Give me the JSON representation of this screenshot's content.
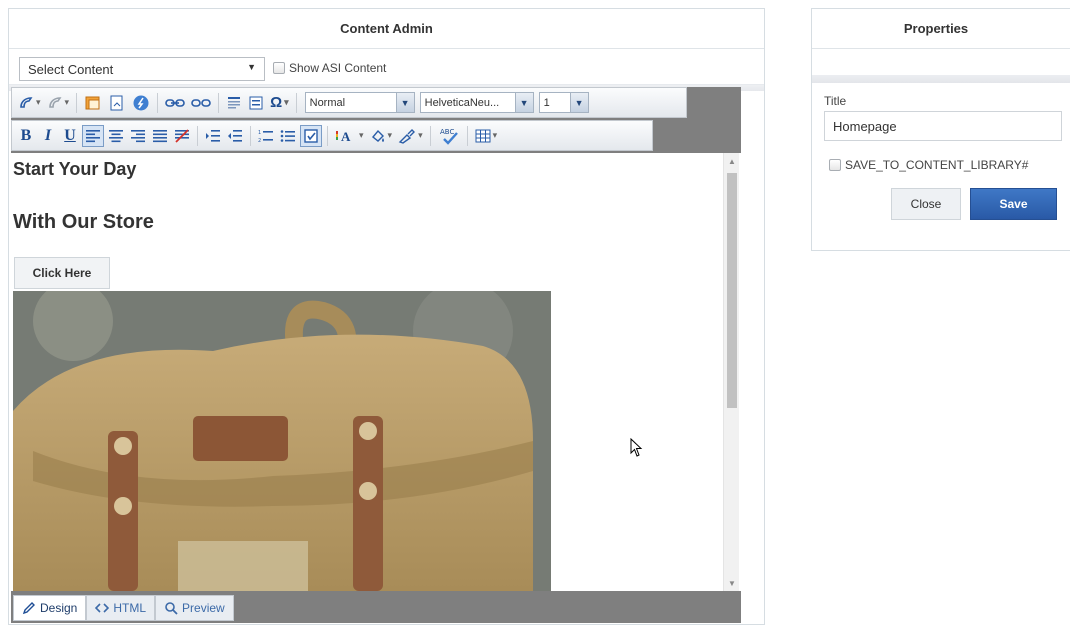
{
  "content_admin": {
    "title": "Content Admin",
    "select_value": "Select Content",
    "show_asi_label": "Show ASI Content"
  },
  "toolbar": {
    "style_value": "Normal",
    "font_value": "HelveticaNeu...",
    "size_value": "1",
    "bold": "B",
    "italic": "I",
    "underline": "U",
    "spellcheck": "ABC",
    "special_char": "Ω"
  },
  "editor_content": {
    "heading1": "Start Your Day",
    "heading2": "With Our Store",
    "button_text": "Click Here"
  },
  "modes": {
    "design": "Design",
    "html": "HTML",
    "preview": "Preview"
  },
  "properties": {
    "title": "Properties",
    "title_label": "Title",
    "title_value": "Homepage",
    "save_to_library_label": "SAVE_TO_CONTENT_LIBRARY#",
    "close_label": "Close",
    "save_label": "Save"
  },
  "colors": {
    "save_button": "#2f66b3",
    "editor_frame": "#7f7f7f",
    "icon_blue": "#2a5da8"
  }
}
